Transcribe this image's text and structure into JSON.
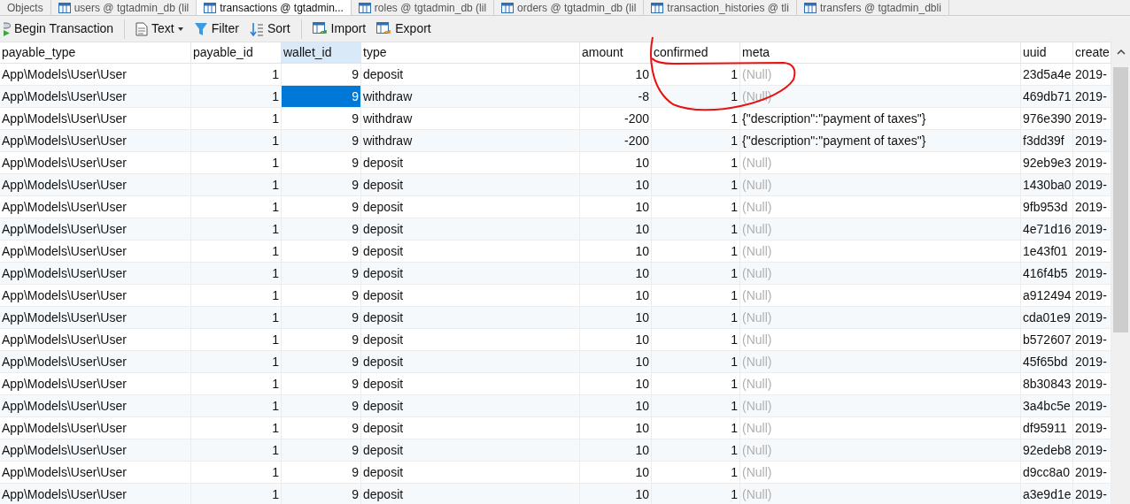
{
  "tabs": [
    {
      "label": "Objects",
      "selected": false
    },
    {
      "label": "users @ tgtadmin_db (lil",
      "selected": false
    },
    {
      "label": "transactions @ tgtadmin...",
      "selected": true
    },
    {
      "label": "roles @ tgtadmin_db (lil",
      "selected": false
    },
    {
      "label": "orders @ tgtadmin_db (lil",
      "selected": false
    },
    {
      "label": "transaction_histories @ tli",
      "selected": false
    },
    {
      "label": "transfers @ tgtadmin_dbli",
      "selected": false
    }
  ],
  "toolbar": [
    {
      "label": "Begin Transaction",
      "kind": "transaction"
    },
    {
      "kind": "separator"
    },
    {
      "label": "Text",
      "kind": "text"
    },
    {
      "label": "Filter",
      "kind": "filter"
    },
    {
      "label": "Sort",
      "kind": "sort"
    },
    {
      "kind": "separator"
    },
    {
      "label": "Import",
      "kind": "import"
    },
    {
      "label": "Export",
      "kind": "export"
    }
  ],
  "table": {
    "columns": [
      {
        "label": "payable_type",
        "kind": "text",
        "selected": false
      },
      {
        "label": "payable_id",
        "kind": "number",
        "selected": false
      },
      {
        "label": "wallet_id",
        "kind": "number",
        "selected": true
      },
      {
        "label": "type",
        "kind": "text",
        "selected": false
      },
      {
        "label": "amount",
        "kind": "number",
        "selected": false
      },
      {
        "label": "confirmed",
        "kind": "number",
        "selected": false
      },
      {
        "label": "meta",
        "kind": "text",
        "selected": false
      },
      {
        "label": "uuid",
        "kind": "text",
        "selected": false
      },
      {
        "label": "create",
        "kind": "text",
        "selected": false
      }
    ],
    "rows": [
      {
        "selected": false,
        "cells": [
          "App\\Models\\User\\User",
          "1",
          "9",
          "deposit",
          "10",
          "1",
          {
            "text": "(Null)",
            "kind": "null"
          },
          "23d5a4e",
          "2019-"
        ]
      },
      {
        "selected": true,
        "cells": [
          "App\\Models\\User\\User",
          "1",
          "9",
          "withdraw",
          "-8",
          "1",
          {
            "text": "(Null)",
            "kind": "null"
          },
          "469db71",
          "2019-"
        ]
      },
      {
        "selected": false,
        "cells": [
          "App\\Models\\User\\User",
          "1",
          "9",
          "withdraw",
          "-200",
          "1",
          "{\"description\":\"payment of taxes\"}",
          "976e390",
          "2019-"
        ]
      },
      {
        "selected": false,
        "cells": [
          "App\\Models\\User\\User",
          "1",
          "9",
          "withdraw",
          "-200",
          "1",
          "{\"description\":\"payment of taxes\"}",
          "f3dd39f",
          "2019-"
        ]
      },
      {
        "selected": false,
        "cells": [
          "App\\Models\\User\\User",
          "1",
          "9",
          "deposit",
          "10",
          "1",
          {
            "text": "(Null)",
            "kind": "null"
          },
          "92eb9e3",
          "2019-"
        ]
      },
      {
        "selected": false,
        "cells": [
          "App\\Models\\User\\User",
          "1",
          "9",
          "deposit",
          "10",
          "1",
          {
            "text": "(Null)",
            "kind": "null"
          },
          "1430ba0",
          "2019-"
        ]
      },
      {
        "selected": false,
        "cells": [
          "App\\Models\\User\\User",
          "1",
          "9",
          "deposit",
          "10",
          "1",
          {
            "text": "(Null)",
            "kind": "null"
          },
          "9fb953d",
          "2019-"
        ]
      },
      {
        "selected": false,
        "cells": [
          "App\\Models\\User\\User",
          "1",
          "9",
          "deposit",
          "10",
          "1",
          {
            "text": "(Null)",
            "kind": "null"
          },
          "4e71d16",
          "2019-"
        ]
      },
      {
        "selected": false,
        "cells": [
          "App\\Models\\User\\User",
          "1",
          "9",
          "deposit",
          "10",
          "1",
          {
            "text": "(Null)",
            "kind": "null"
          },
          "1e43f01",
          "2019-"
        ]
      },
      {
        "selected": false,
        "cells": [
          "App\\Models\\User\\User",
          "1",
          "9",
          "deposit",
          "10",
          "1",
          {
            "text": "(Null)",
            "kind": "null"
          },
          "416f4b5",
          "2019-"
        ]
      },
      {
        "selected": false,
        "cells": [
          "App\\Models\\User\\User",
          "1",
          "9",
          "deposit",
          "10",
          "1",
          {
            "text": "(Null)",
            "kind": "null"
          },
          "a912494",
          "2019-"
        ]
      },
      {
        "selected": false,
        "cells": [
          "App\\Models\\User\\User",
          "1",
          "9",
          "deposit",
          "10",
          "1",
          {
            "text": "(Null)",
            "kind": "null"
          },
          "cda01e9",
          "2019-"
        ]
      },
      {
        "selected": false,
        "cells": [
          "App\\Models\\User\\User",
          "1",
          "9",
          "deposit",
          "10",
          "1",
          {
            "text": "(Null)",
            "kind": "null"
          },
          "b572607",
          "2019-"
        ]
      },
      {
        "selected": false,
        "cells": [
          "App\\Models\\User\\User",
          "1",
          "9",
          "deposit",
          "10",
          "1",
          {
            "text": "(Null)",
            "kind": "null"
          },
          "45f65bd",
          "2019-"
        ]
      },
      {
        "selected": false,
        "cells": [
          "App\\Models\\User\\User",
          "1",
          "9",
          "deposit",
          "10",
          "1",
          {
            "text": "(Null)",
            "kind": "null"
          },
          "8b30843",
          "2019-"
        ]
      },
      {
        "selected": false,
        "cells": [
          "App\\Models\\User\\User",
          "1",
          "9",
          "deposit",
          "10",
          "1",
          {
            "text": "(Null)",
            "kind": "null"
          },
          "3a4bc5e",
          "2019-"
        ]
      },
      {
        "selected": false,
        "cells": [
          "App\\Models\\User\\User",
          "1",
          "9",
          "deposit",
          "10",
          "1",
          {
            "text": "(Null)",
            "kind": "null"
          },
          "df95911",
          "2019-"
        ]
      },
      {
        "selected": false,
        "cells": [
          "App\\Models\\User\\User",
          "1",
          "9",
          "deposit",
          "10",
          "1",
          {
            "text": "(Null)",
            "kind": "null"
          },
          "92edeb8",
          "2019-"
        ]
      },
      {
        "selected": false,
        "cells": [
          "App\\Models\\User\\User",
          "1",
          "9",
          "deposit",
          "10",
          "1",
          {
            "text": "(Null)",
            "kind": "null"
          },
          "d9cc8a0",
          "2019-"
        ]
      },
      {
        "selected": false,
        "cells": [
          "App\\Models\\User\\User",
          "1",
          "9",
          "deposit",
          "10",
          "1",
          {
            "text": "(Null)",
            "kind": "null"
          },
          "a3e9d1e",
          "2019-"
        ]
      }
    ]
  }
}
